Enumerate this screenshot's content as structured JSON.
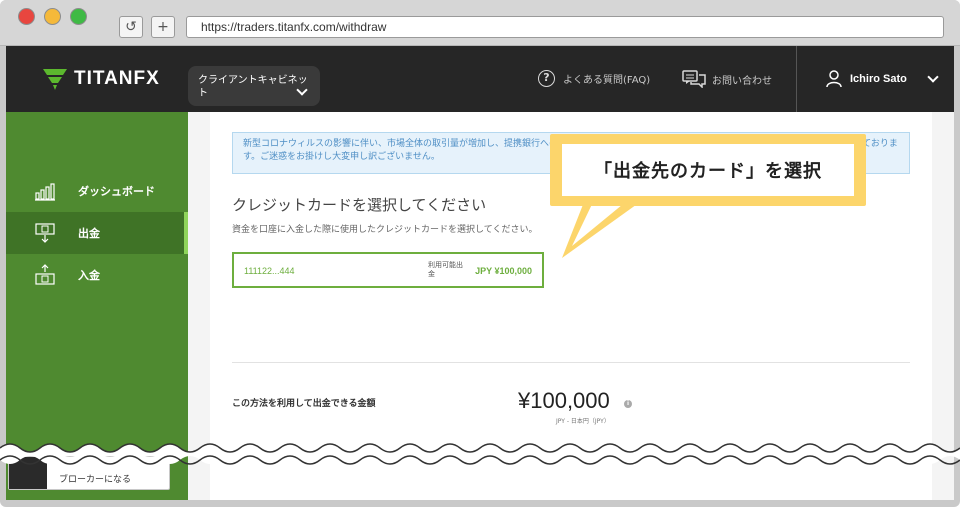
{
  "browser": {
    "url": "https://traders.titanfx.com/withdraw",
    "reload_glyph": "↺",
    "newtab_glyph": "+"
  },
  "header": {
    "logo_text": "TITANFX",
    "cabinet_label": "クライアントキャビネット",
    "faq_label": "よくある質問(FAQ)",
    "contact_label": "お問い合わせ",
    "user_name": "Ichiro Sato"
  },
  "sidebar": {
    "items": [
      {
        "label": "ダッシュボード",
        "icon": "bar-chart-icon"
      },
      {
        "label": "出金",
        "icon": "withdraw-icon"
      },
      {
        "label": "入金",
        "icon": "deposit-icon"
      }
    ],
    "broker_label": "ブローカーになる"
  },
  "main": {
    "notice": "新型コロナウィルスの影響に伴い、市場全体の取引量が増加し、提携銀行への出金処理に通常よりもお時間を頂いております。最小限に収めるべく尽力しております。ご迷惑をお掛けし大変申し訳ございません。",
    "title": "クレジットカードを選択してください",
    "subtitle": "資金を口座に入金した際に使用したクレジットカードを選択してください。",
    "card": {
      "number": "111122...444",
      "available_label": "利用可能出金",
      "amount": "JPY ¥100,000"
    },
    "amount_label": "この方法を利用して出金できる金額",
    "amount_value": "¥100,000",
    "amount_currency": "JPY - 日本円（JPY）"
  },
  "callout": {
    "text": "「出金先のカード」を選択"
  },
  "colors": {
    "sidebar_green": "#4f8a30",
    "accent_green": "#6dae3e",
    "callout_yellow": "#fcd56b",
    "topbar_dark": "#262626"
  }
}
